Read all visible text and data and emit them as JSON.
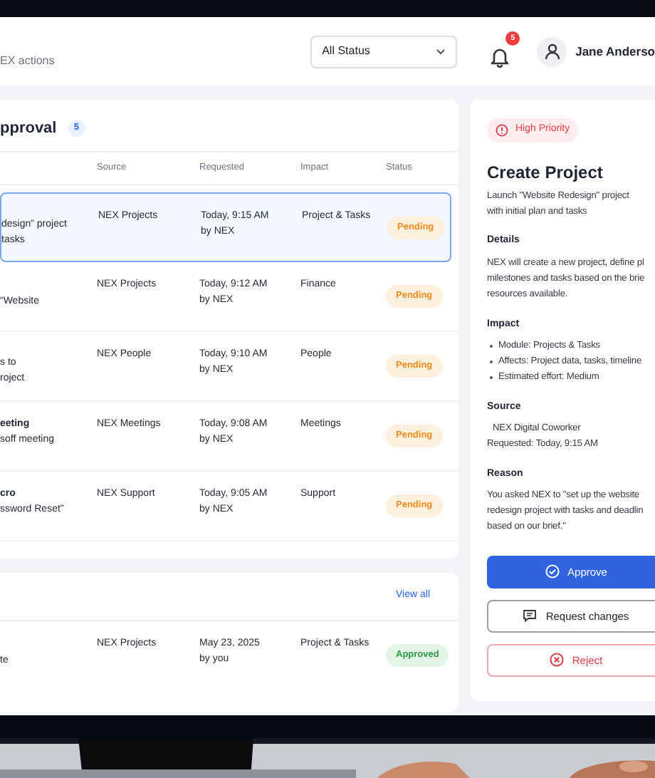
{
  "header": {
    "subtitle": "EX actions",
    "status_filter": {
      "value": "All Status"
    },
    "notifications": {
      "count": "5"
    },
    "user": {
      "name": "Jane Anderso"
    }
  },
  "approval_card": {
    "title": "pproval",
    "count": "5",
    "columns": [
      "Source",
      "Requested",
      "Impact",
      "Status"
    ],
    "rows": [
      {
        "description": [
          "design” project",
          "tasks"
        ],
        "source": "NEX Projects",
        "requested": [
          "Today, 9:15 AM",
          "by NEX"
        ],
        "impact": "Project & Tasks",
        "status": "Pending",
        "kind": "pending",
        "selected": true
      },
      {
        "description": [
          "“Website"
        ],
        "source": "NEX Projects",
        "requested": [
          "Today, 9:12 AM",
          "by NEX"
        ],
        "impact": "Finance",
        "status": "Pending",
        "kind": "pending",
        "selected": false
      },
      {
        "description": [
          "s to",
          "roject"
        ],
        "source": "NEX People",
        "requested": [
          "Today, 9:10 AM",
          "by NEX"
        ],
        "impact": "People",
        "status": "Pending",
        "kind": "pending",
        "selected": false
      },
      {
        "title": "eeting",
        "description": [
          "soff meeting"
        ],
        "source": "NEX Meetings",
        "requested": [
          "Today, 9:08 AM",
          "by NEX"
        ],
        "impact": "Meetings",
        "status": "Pending",
        "kind": "pending",
        "selected": false
      },
      {
        "title": "cro",
        "description": [
          "ssword Reset”"
        ],
        "source": "NEX Support",
        "requested": [
          "Today, 9:05 AM",
          "by NEX"
        ],
        "impact": "Support",
        "status": "Pending",
        "kind": "pending",
        "selected": false
      }
    ]
  },
  "recent_card": {
    "link": "View all",
    "rows": [
      {
        "description": [
          "te"
        ],
        "source": "NEX Projects",
        "requested": [
          "May 23, 2025",
          "by you"
        ],
        "impact": "Project & Tasks",
        "status": "Approved",
        "kind": "approved",
        "selected": false
      }
    ]
  },
  "detail": {
    "priority": "High Priority",
    "title": "Create Project",
    "summary": [
      "Launch \"Website Redesign\" project",
      "with initial plan and tasks"
    ],
    "sections": [
      {
        "heading": "Details",
        "kind": "paragraph",
        "lines": [
          "NEX will create a new project, define pl",
          "milestones and tasks based on the brie",
          "resources available."
        ]
      },
      {
        "heading": "Impact",
        "kind": "bullets",
        "lines": [
          "Module: Projects & Tasks",
          "Affects: Project data, tasks, timeline",
          "Estimated effort: Medium"
        ]
      },
      {
        "heading": "Source",
        "kind": "source",
        "lines": [
          "NEX Digital Coworker",
          "Requested: Today, 9:15 AM"
        ]
      },
      {
        "heading": "Reason",
        "kind": "paragraph",
        "lines": [
          "You asked NEX to \"set up the website",
          "redesign project with tasks and deadlin",
          "based on our brief.\""
        ]
      }
    ],
    "actions": [
      {
        "label": "Approve",
        "kind": "approve"
      },
      {
        "label": "Request changes",
        "kind": "changes"
      },
      {
        "label": "Reject",
        "kind": "reject"
      }
    ]
  }
}
